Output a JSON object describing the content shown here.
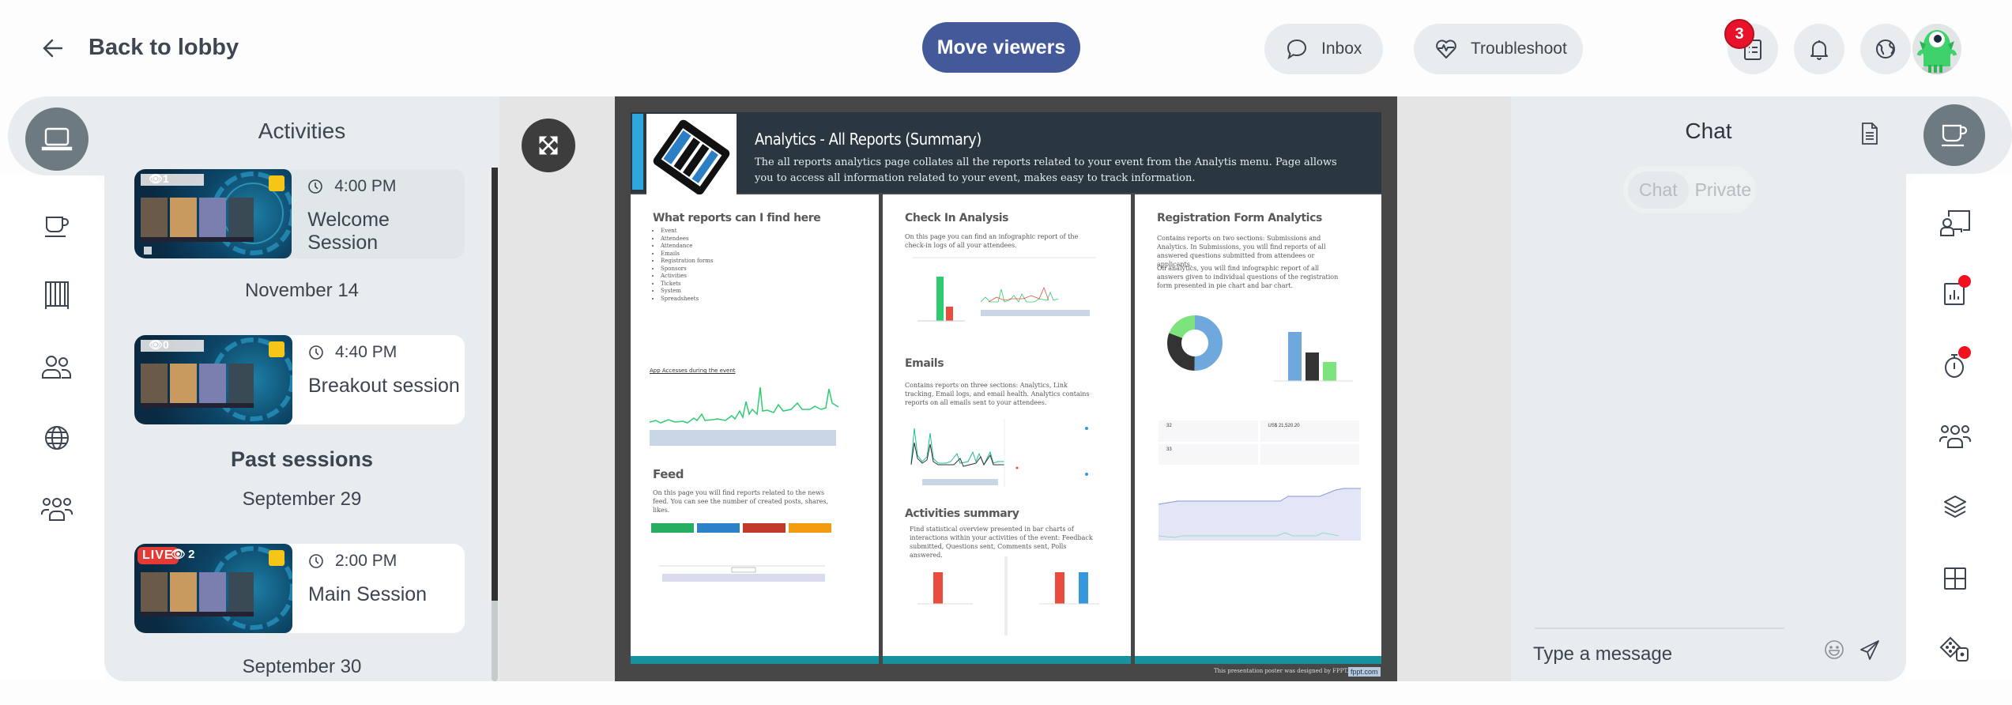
{
  "header": {
    "back_label": "Back to lobby",
    "move_viewers_label": "Move viewers",
    "inbox_label": "Inbox",
    "troubleshoot_label": "Troubleshoot",
    "tasks_badge_count": "3",
    "accent_color": "#43599a",
    "badge_color": "#e8132a"
  },
  "left_nav": {
    "items": [
      "activities",
      "lounge",
      "expo",
      "people",
      "web",
      "groups"
    ],
    "active": "activities"
  },
  "activities": {
    "title": "Activities",
    "upcoming": [
      {
        "time": "4:00 PM",
        "name": "Welcome Session",
        "viewers": "1",
        "live": false
      }
    ],
    "groups": [
      {
        "date": "November 14",
        "items": [
          {
            "time": "4:40 PM",
            "name": "Breakout session",
            "viewers": "0",
            "live": false
          }
        ]
      }
    ],
    "past_heading": "Past sessions",
    "past_groups": [
      {
        "date": "September 29",
        "items": [
          {
            "time": "2:00 PM",
            "name": "Main Session",
            "viewers": "2",
            "live": true,
            "live_label": "LIVE"
          }
        ]
      },
      {
        "date": "September 30",
        "items": []
      }
    ]
  },
  "slide": {
    "title": "Analytics - All Reports (Summary)",
    "description": "The all reports analytics page collates all the reports related to your event from the Analytis menu. Page allows you to access all information related to your event, makes easy to track information.",
    "col1": {
      "heading": "What reports can I find here",
      "list": [
        "Event",
        "Attendees",
        "Attendance",
        "Emails",
        "Registration forms",
        "Sponsors",
        "Activities",
        "Tickets",
        "System",
        "Spreadsheets"
      ],
      "chart_label": "App Accesses during the event",
      "feed_heading": "Feed",
      "feed_text": "On this page you will find reports related to the news feed. You can see the number of created posts, shares, likes."
    },
    "col2": {
      "checkin_heading": "Check In Analysis",
      "checkin_text": "On this page you can find an infographic report of the check-in logs of all your attendees.",
      "emails_heading": "Emails",
      "emails_text": "Contains reports on three sections: Analytics, Link tracking, Email logs, and email health. Analytics contains reports on all emails sent to your attendees.",
      "activities_heading": "Activities summary",
      "activities_text": "Find statistical overview presented in bar charts of interactions within your activities of the event: Feedback submitted, Questions sent, Comments sent, Polls answered."
    },
    "col3": {
      "heading": "Registration Form Analytics",
      "text1": "Contains reports on two sections: Submissions and Analytics. In Submissions, you will find reports of all answered questions submitted from attendees or applicants.",
      "text2": "On analytics, you will find infographic report of all answers given to individual questions of the registration form presented in pie chart and bar chart.",
      "sales_value": "US$ 21,520.20",
      "enrolled_value": "32",
      "pending_value": "33"
    },
    "footer_text": "This presentation poster was designed by FPPT.",
    "footer_brand": "fppt.com"
  },
  "chat": {
    "title": "Chat",
    "tabs": [
      "Chat",
      "Private"
    ],
    "active_tab": "Chat",
    "input_placeholder": "Type a message"
  },
  "right_nav": {
    "items": [
      "lounge",
      "presenter",
      "polls",
      "timer",
      "people",
      "layers",
      "grid",
      "games"
    ],
    "active": "lounge",
    "notification_dots": [
      "polls",
      "timer"
    ]
  }
}
